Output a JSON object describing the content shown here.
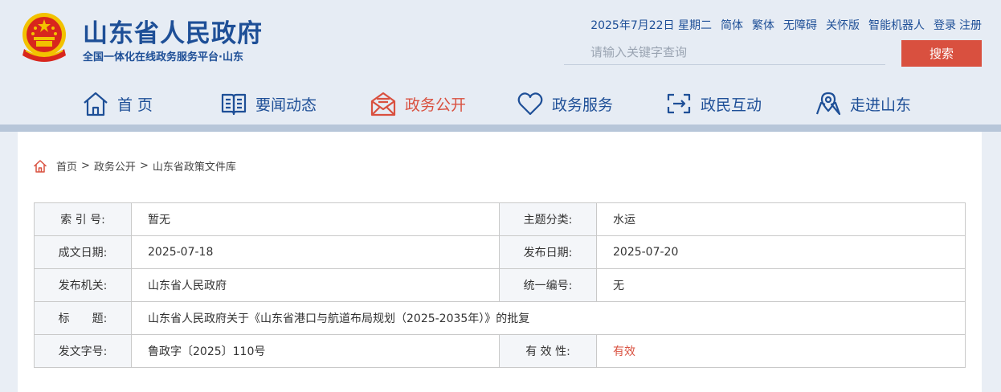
{
  "header": {
    "site_title": "山东省人民政府",
    "site_subtitle": "全国一体化在线政务服务平台·山东",
    "emblem_icon": "national-emblem-icon",
    "topbar": {
      "date": "2025年7月22日 星期二",
      "simplified": "简体",
      "traditional": "繁体",
      "accessibility": "无障碍",
      "elderly": "关怀版",
      "robot": "智能机器人",
      "login": "登录",
      "register": "注册"
    },
    "search": {
      "placeholder": "请输入关键字查询",
      "button": "搜索"
    },
    "colors": {
      "brand": "#1e4f97",
      "accent": "#d9503f"
    }
  },
  "nav": {
    "items": [
      {
        "label": "首 页",
        "icon": "home-icon"
      },
      {
        "label": "要闻动态",
        "icon": "book-icon"
      },
      {
        "label": "政务公开",
        "icon": "mail-open-icon",
        "active": true
      },
      {
        "label": "政务服务",
        "icon": "heart-icon"
      },
      {
        "label": "政民互动",
        "icon": "interaction-icon"
      },
      {
        "label": "走进山东",
        "icon": "map-pin-icon"
      }
    ]
  },
  "breadcrumb": {
    "icon": "home-icon",
    "items": [
      "首页",
      "政务公开",
      "山东省政策文件库"
    ],
    "separator": ">"
  },
  "doc_info": {
    "index_label": "索 引 号:",
    "index_value": "暂无",
    "topic_label": "主题分类:",
    "topic_value": "水运",
    "created_label": "成文日期:",
    "created_value": "2025-07-18",
    "published_label": "发布日期:",
    "published_value": "2025-07-20",
    "issuer_label": "发布机关:",
    "issuer_value": "山东省人民政府",
    "code_label": "统一编号:",
    "code_value": "无",
    "title_label": "标　　题:",
    "title_value": "山东省人民政府关于《山东省港口与航道布局规划（2025-2035年）》的批复",
    "doc_no_label": "发文字号:",
    "doc_no_value": "鲁政字〔2025〕110号",
    "validity_label": "有 效 性:",
    "validity_value": "有效"
  }
}
